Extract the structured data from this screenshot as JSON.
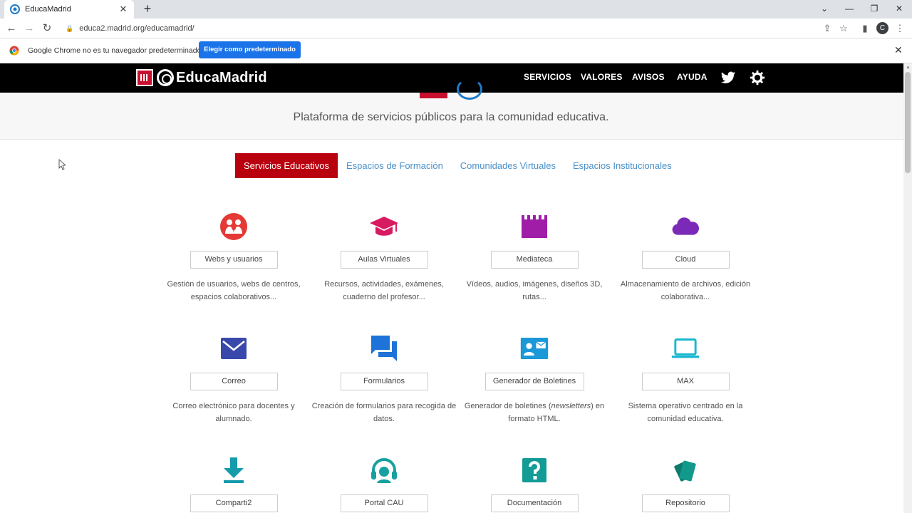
{
  "browser": {
    "tab_title": "EducaMadrid",
    "url": "educa2.madrid.org/educamadrid/",
    "avatar_letter": "C",
    "infobar_message": "Google Chrome no es tu navegador predeterminado",
    "infobar_button": "Elegir como predeterminado"
  },
  "site": {
    "brand": "EducaMadrid",
    "nav": [
      "SERVICIOS",
      "VALORES",
      "AVISOS",
      "AYUDA"
    ],
    "tagline": "Plataforma de servicios públicos para la comunidad educativa."
  },
  "tabs": [
    "Servicios Educativos",
    "Espacios de Formación",
    "Comunidades Virtuales",
    "Espacios Institucionales"
  ],
  "services": [
    {
      "label": "Webs y usuarios",
      "desc": "Gestión de usuarios, webs de centros, espacios colaborativos...",
      "icon": "users-circle-icon",
      "color": "#e53935"
    },
    {
      "label": "Aulas Virtuales",
      "desc": "Recursos, actividades, exámenes, cuaderno del profesor...",
      "icon": "graduation-cap-icon",
      "color": "#d81b60"
    },
    {
      "label": "Mediateca",
      "desc": "Vídeos, audios, imágenes, diseños 3D, rutas...",
      "icon": "film-icon",
      "color": "#a01da8"
    },
    {
      "label": "Cloud",
      "desc": "Almacenamiento de archivos, edición colaborativa...",
      "icon": "cloud-icon",
      "color": "#7b2ab8"
    },
    {
      "label": "Correo",
      "desc": "Correo electrónico para docentes y alumnado.",
      "icon": "envelope-icon",
      "color": "#3949ab"
    },
    {
      "label": "Formularios",
      "desc": "Creación de formularios para recogida de datos.",
      "icon": "chat-bubbles-icon",
      "color": "#1e73d8"
    },
    {
      "label": "Generador de Boletines",
      "desc_pre": "Generador de boletines (",
      "desc_em": "newsletters",
      "desc_post": ") en formato HTML.",
      "icon": "contact-card-icon",
      "color": "#1a98d8"
    },
    {
      "label": "MAX",
      "desc": "Sistema operativo centrado en la comunidad educativa.",
      "icon": "laptop-icon",
      "color": "#1ab7d0"
    },
    {
      "label": "Comparti2",
      "icon": "download-icon",
      "color": "#169bab"
    },
    {
      "label": "Portal CAU",
      "icon": "headset-icon",
      "color": "#16a0a0"
    },
    {
      "label": "Documentación",
      "icon": "question-icon",
      "color": "#139b96"
    },
    {
      "label": "Repositorio",
      "icon": "cards-icon",
      "color": "#12998c"
    }
  ]
}
